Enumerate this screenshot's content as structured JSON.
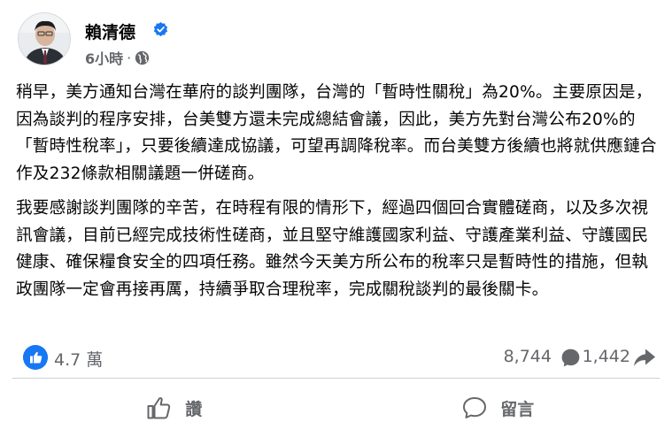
{
  "post": {
    "author": "賴清德",
    "time": "6小時",
    "separator": "·",
    "paragraphs": [
      "稍早，美方通知台灣在華府的談判團隊，台灣的「暫時性關稅」為20%。主要原因是，因為談判的程序安排，台美雙方還未完成總結會議，因此，美方先對台灣公布20%的「暫時性稅率」，只要後續達成協議，可望再調降稅率。而台美雙方後續也將就供應鏈合作及232條款相關議題一併磋商。",
      "我要感謝談判團隊的辛苦，在時程有限的情形下，經過四個回合實體磋商，以及多次視訊會議，目前已經完成技術性磋商，並且堅守維護國家利益、守護產業利益、守護國民健康、確保糧食安全的四項任務。雖然今天美方所公布的稅率只是暫時性的措施，但執政團隊一定會再接再厲，持續爭取合理稅率，完成關稅談判的最後關卡。"
    ]
  },
  "stats": {
    "reactions": "4.7 萬",
    "comments": "8,744",
    "shares": "1,442"
  },
  "actions": {
    "like": "讚",
    "comment": "留言"
  },
  "colors": {
    "accent": "#1877f2",
    "secondary_text": "#65676b",
    "text": "#050505",
    "divider": "#ced0d4"
  },
  "icons": {
    "verified": "verified-badge-icon",
    "privacy": "globe-icon",
    "reaction": "like-icon",
    "comment": "comment-icon",
    "share": "share-icon"
  }
}
